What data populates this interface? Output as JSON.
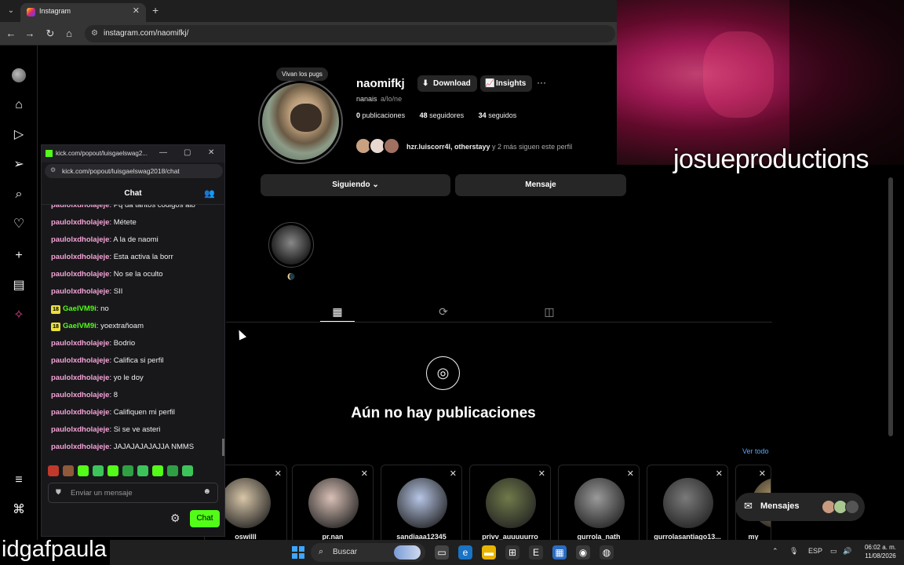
{
  "browser": {
    "tab_title": "Instagram",
    "url": "instagram.com/naomifkj/"
  },
  "profile": {
    "username": "naomifkj",
    "download_label": "Download",
    "insights_label": "Insights",
    "more_label": "···",
    "full_name": "nanais",
    "pronouns": "a/lo/ne",
    "note": "Vivan los pugs",
    "posts_count": "0",
    "posts_label": "publicaciones",
    "followers_count": "48",
    "followers_label": "seguidores",
    "following_count": "34",
    "following_label": "seguidos",
    "followed_by_names": "hzr.luiscorr4l, otherstayy",
    "followed_by_rest": " y 2 más siguen este perfil",
    "following_button": "Siguiendo",
    "message_button": "Mensaje",
    "highlight_label": "🌘",
    "empty_title": "Aún no hay publicaciones",
    "see_all": "Ver todo"
  },
  "suggestions": [
    {
      "name": "oswilll",
      "color": "#d8c6a8"
    },
    {
      "name": "pr.nan",
      "color": "#d9c0b6"
    },
    {
      "name": "sandiaaa12345",
      "color": "#b7c6e6"
    },
    {
      "name": "privv_auuuuurro",
      "color": "#6f7a4a"
    },
    {
      "name": "gurrola_nath",
      "color": "#9a9a9a"
    },
    {
      "name": "gurrolasantiago13...",
      "color": "#7a7a7a"
    },
    {
      "name": "my",
      "color": "#b49a6a"
    }
  ],
  "messages_pill": {
    "label": "Mensajes"
  },
  "kick": {
    "window_title": "kick.com/popout/luisgaelswag2...",
    "url": "kick.com/popout/luisgaelswag2018/chat",
    "chat_title": "Chat",
    "input_placeholder": "Enviar un mensaje",
    "send_label": "Chat",
    "messages": [
      {
        "user": "paulolxdholajeje",
        "text": "Pq da tantos codigos alb",
        "badge": ""
      },
      {
        "user": "paulolxdholajeje",
        "text": "Métete",
        "badge": ""
      },
      {
        "user": "paulolxdholajeje",
        "text": "A la de naomi",
        "badge": ""
      },
      {
        "user": "paulolxdholajeje",
        "text": "Esta activa la borr",
        "badge": ""
      },
      {
        "user": "paulolxdholajeje",
        "text": "No se la oculto",
        "badge": ""
      },
      {
        "user": "paulolxdholajeje",
        "text": "SII",
        "badge": ""
      },
      {
        "user": "GaelVM9i",
        "text": "no",
        "badge": "18"
      },
      {
        "user": "GaelVM9i",
        "text": "yoextrañoam",
        "badge": "18"
      },
      {
        "user": "paulolxdholajeje",
        "text": "Bodrio",
        "badge": ""
      },
      {
        "user": "paulolxdholajeje",
        "text": "Califica si perfil",
        "badge": ""
      },
      {
        "user": "paulolxdholajeje",
        "text": "yo le doy",
        "badge": ""
      },
      {
        "user": "paulolxdholajeje",
        "text": "8",
        "badge": ""
      },
      {
        "user": "paulolxdholajeje",
        "text": "Califiquen mi perfil",
        "badge": ""
      },
      {
        "user": "paulolxdholajeje",
        "text": "Si se ve asteri",
        "badge": ""
      },
      {
        "user": "paulolxdholajeje",
        "text": "JAJAJAJAJAJJA NMMS",
        "badge": ""
      }
    ]
  },
  "overlay": {
    "streamer_name": "josueproductions",
    "bottom_name": "idgafpaula"
  },
  "taskbar": {
    "search_label": "Buscar",
    "language": "ESP",
    "time": "06:02 a. m.",
    "date": "11/08/2026"
  },
  "colors": {
    "kick_green": "#53fc18",
    "chat_username": "#f5a3d6",
    "link_blue": "#58a6ff"
  }
}
